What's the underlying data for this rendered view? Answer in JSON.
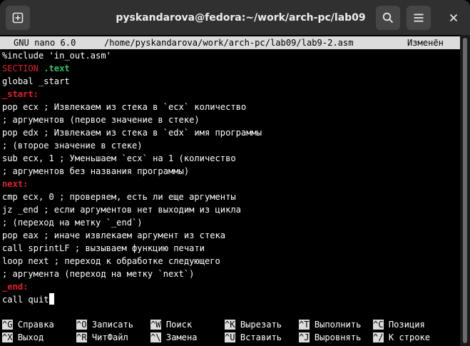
{
  "window": {
    "title": "pyskandarova@fedora:~/work/arch-pc/lab09",
    "new_tab_icon": "plus-square-icon",
    "search_icon": "magnifier-icon",
    "menu_icon": "hamburger-icon",
    "close_icon": "close-x-icon"
  },
  "nano": {
    "version": "GNU nano 6.0",
    "file_path": "/home/pyskandarova/work/arch-pc/lab09/lab9-2.asm",
    "state": "Изменён"
  },
  "code": [
    {
      "parts": [
        {
          "t": "%include 'in_out.asm'",
          "c": ""
        }
      ]
    },
    {
      "parts": [
        {
          "t": "SECTION",
          "c": "red"
        },
        {
          "t": " ",
          "c": ""
        },
        {
          "t": ".text",
          "c": "green"
        }
      ]
    },
    {
      "parts": [
        {
          "t": "global _start",
          "c": ""
        }
      ]
    },
    {
      "parts": [
        {
          "t": "_start:",
          "c": "red bold"
        }
      ]
    },
    {
      "parts": [
        {
          "t": "pop ecx ; Извлекаем из стека в `ecx` количество",
          "c": ""
        }
      ]
    },
    {
      "parts": [
        {
          "t": "; аргументов (первое значение в стеке)",
          "c": ""
        }
      ]
    },
    {
      "parts": [
        {
          "t": "pop edx ; Извлекаем из стека в `edx` имя программы",
          "c": ""
        }
      ]
    },
    {
      "parts": [
        {
          "t": "; (второе значение в стеке)",
          "c": ""
        }
      ]
    },
    {
      "parts": [
        {
          "t": "sub ecx, 1 ; Уменьшаем `ecx` на 1 (количество",
          "c": ""
        }
      ]
    },
    {
      "parts": [
        {
          "t": "; аргументов без названия программы)",
          "c": ""
        }
      ]
    },
    {
      "parts": [
        {
          "t": "next:",
          "c": "red bold"
        }
      ]
    },
    {
      "parts": [
        {
          "t": "cmp ecx, 0 ; проверяем, есть ли еще аргументы",
          "c": ""
        }
      ]
    },
    {
      "parts": [
        {
          "t": "jz _end ; если аргументов нет выходим из цикла",
          "c": ""
        }
      ]
    },
    {
      "parts": [
        {
          "t": "; (переход на метку `_end`)",
          "c": ""
        }
      ]
    },
    {
      "parts": [
        {
          "t": "pop eax ; иначе извлекаем аргумент из стека",
          "c": ""
        }
      ]
    },
    {
      "parts": [
        {
          "t": "call sprintLF ; вызываем функцию печати",
          "c": ""
        }
      ]
    },
    {
      "parts": [
        {
          "t": "loop next ; переход к обработке следующего",
          "c": ""
        }
      ]
    },
    {
      "parts": [
        {
          "t": "; аргумента (переход на метку `next`)",
          "c": ""
        }
      ]
    },
    {
      "parts": [
        {
          "t": "_end:",
          "c": "red bold"
        }
      ]
    },
    {
      "parts": [
        {
          "t": "call quit",
          "c": ""
        }
      ],
      "cursor": true
    }
  ],
  "shortcuts": {
    "row1": [
      {
        "key": "^G",
        "label": "Справка"
      },
      {
        "key": "^O",
        "label": "Записать"
      },
      {
        "key": "^W",
        "label": "Поиск"
      },
      {
        "key": "^K",
        "label": "Вырезать"
      },
      {
        "key": "^T",
        "label": "Выполнить"
      },
      {
        "key": "^C",
        "label": "Позиция"
      }
    ],
    "row2": [
      {
        "key": "^X",
        "label": "Выход"
      },
      {
        "key": "^R",
        "label": "ЧитФайл"
      },
      {
        "key": "^\\",
        "label": "Замена"
      },
      {
        "key": "^U",
        "label": "Вставить"
      },
      {
        "key": "^J",
        "label": "Выровнять"
      },
      {
        "key": "^/",
        "label": "К строке"
      }
    ]
  }
}
